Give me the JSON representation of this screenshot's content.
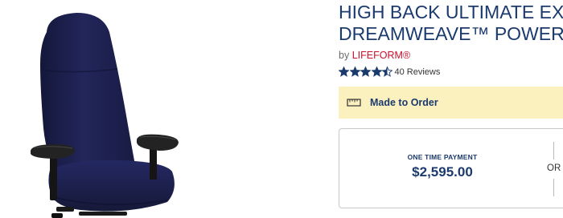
{
  "product": {
    "image_icon": "office-chair-image",
    "title_line1": "HIGH BACK ULTIMATE EXECUTIVE CHAIR",
    "title_line2": "DREAMWEAVE™ POWERPLAY",
    "by_label": "by",
    "brand": "LIFEFORM®",
    "rating": 4.5,
    "stars_max": 5,
    "reviews": "40 Reviews"
  },
  "availability": {
    "icon": "ruler-icon",
    "text": "Made to Order"
  },
  "payment": {
    "one_time_label": "ONE TIME PAYMENT",
    "one_time_price": "$2,595.00",
    "or_label": "OR"
  },
  "colors": {
    "title": "#1b3a6d",
    "brand_link": "#c8102e",
    "availability_bg": "#fbf1bf",
    "chair_fabric": "#1c1f45"
  }
}
